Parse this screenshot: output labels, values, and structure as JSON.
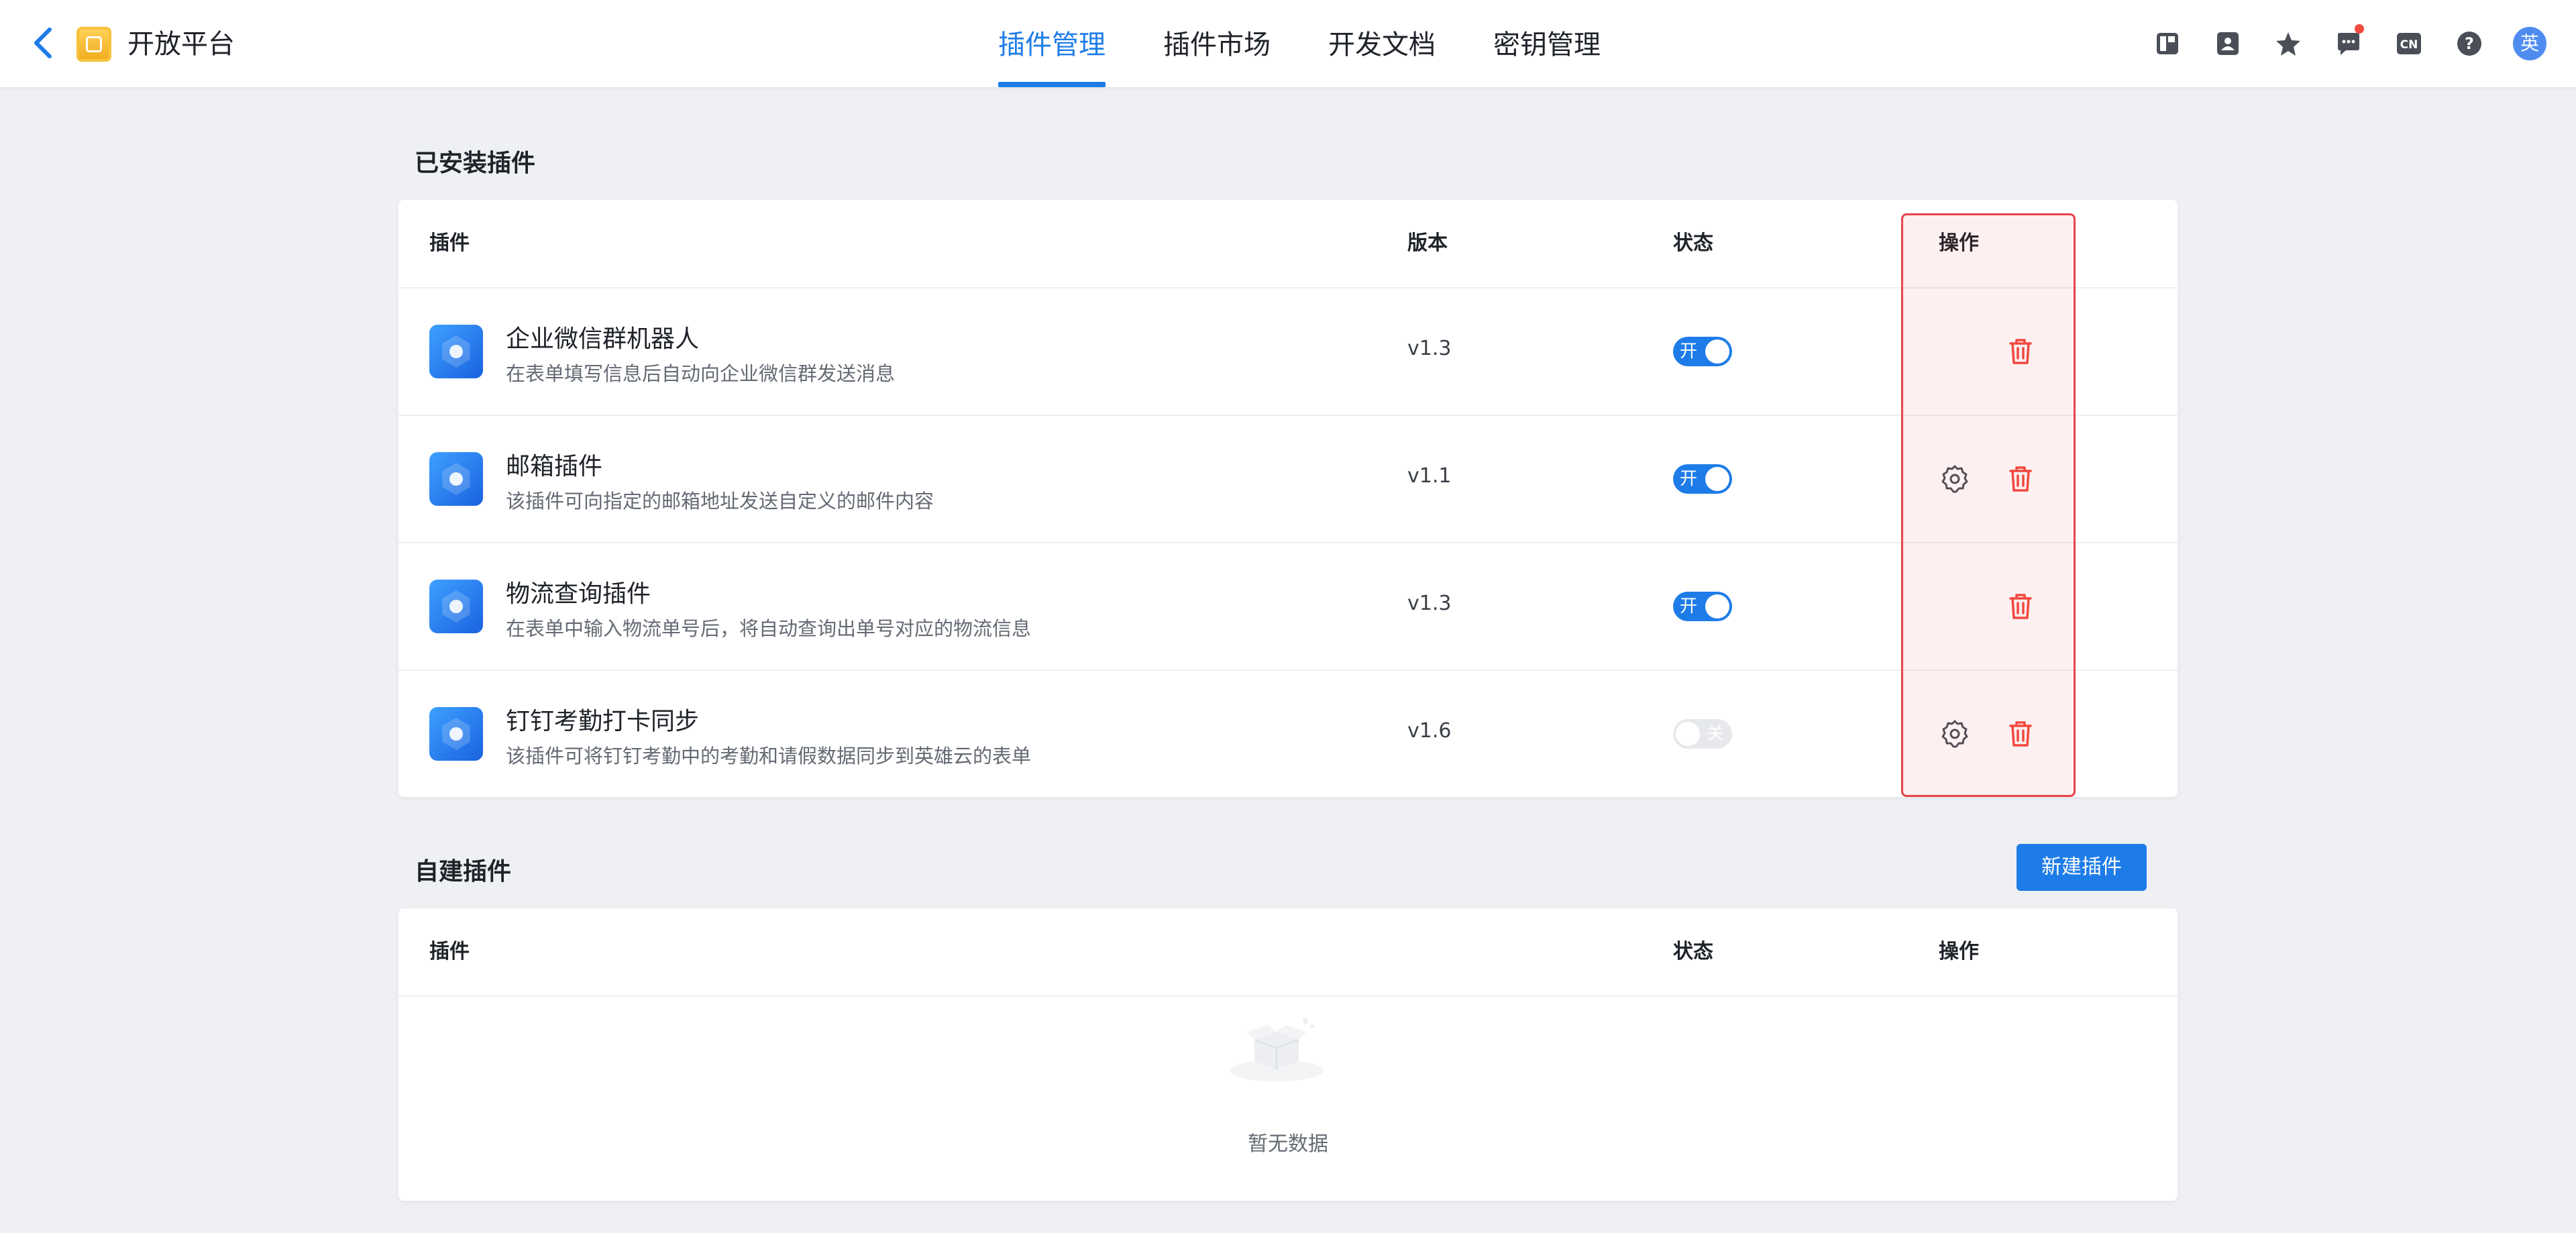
{
  "header": {
    "app_title": "开放平台",
    "tabs": [
      {
        "label": "插件管理",
        "active": true
      },
      {
        "label": "插件市场",
        "active": false
      },
      {
        "label": "开发文档",
        "active": false
      },
      {
        "label": "密钥管理",
        "active": false
      }
    ],
    "tools": [
      "layout-icon",
      "contacts-icon",
      "star-icon",
      "message-icon",
      "language-icon",
      "help-icon"
    ],
    "language_badge": "CN",
    "help_glyph": "?",
    "avatar_text": "英"
  },
  "installed": {
    "title": "已安装插件",
    "columns": {
      "plugin": "插件",
      "version": "版本",
      "status": "状态",
      "actions": "操作"
    },
    "rows": [
      {
        "name": "企业微信群机器人",
        "desc": "在表单填写信息后自动向企业微信群发送消息",
        "version": "v1.3",
        "switch_label": "开",
        "enabled": true,
        "has_settings": false
      },
      {
        "name": "邮箱插件",
        "desc": "该插件可向指定的邮箱地址发送自定义的邮件内容",
        "version": "v1.1",
        "switch_label": "开",
        "enabled": true,
        "has_settings": true
      },
      {
        "name": "物流查询插件",
        "desc": "在表单中输入物流单号后，将自动查询出单号对应的物流信息",
        "version": "v1.3",
        "switch_label": "开",
        "enabled": true,
        "has_settings": false
      },
      {
        "name": "钉钉考勤打卡同步",
        "desc": "该插件可将钉钉考勤中的考勤和请假数据同步到英雄云的表单",
        "version": "v1.6",
        "switch_label": "关",
        "enabled": false,
        "has_settings": true
      }
    ]
  },
  "custom": {
    "title": "自建插件",
    "new_button": "新建插件",
    "columns": {
      "plugin": "插件",
      "status": "状态",
      "actions": "操作"
    },
    "empty_text": "暂无数据"
  },
  "colors": {
    "accent": "#1e7ce8",
    "danger": "#f24a3d",
    "highlight": "#e8434c"
  }
}
